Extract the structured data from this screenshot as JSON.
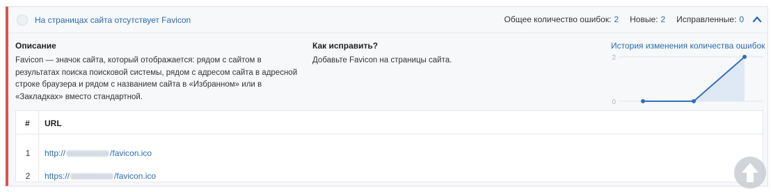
{
  "issue": {
    "title": "На страницах сайта отсутствует Favicon",
    "stats": {
      "total_label": "Общее количество ошибок:",
      "total_value": "2",
      "new_label": "Новые:",
      "new_value": "2",
      "fixed_label": "Исправленные:",
      "fixed_value": "0"
    }
  },
  "description": {
    "title": "Описание",
    "text": "Favicon — значок сайта, который отображается: рядом с сайтом в результатах поиска поисковой системы, рядом с адресом сайта в адресной строке браузера и рядом с названием сайта в «Избранном» или в «Закладках» вместо стандартной."
  },
  "fix": {
    "title": "Как исправить?",
    "text": "Добавьте Favicon на страницы сайта."
  },
  "history": {
    "title": "История изменения количества ошибок"
  },
  "chart_data": {
    "type": "area",
    "x": [
      1,
      2,
      3
    ],
    "series": [
      {
        "values": [
          0,
          0,
          2
        ]
      }
    ],
    "ylim": [
      0,
      2
    ],
    "y_ticks": [
      "0",
      "2"
    ],
    "grid": true,
    "colors": {
      "line": "#2f6fc0",
      "fill": "#dfe9f5",
      "grid": "#e1e4e8"
    }
  },
  "table": {
    "headers": [
      "#",
      "URL"
    ],
    "rows": [
      {
        "num": "1",
        "url_prefix": "http://",
        "url_suffix": "/favicon.ico"
      },
      {
        "num": "2",
        "url_prefix": "https://",
        "url_suffix": "/favicon.ico"
      }
    ]
  },
  "colors": {
    "accent": "#2a6bb0",
    "error_border": "#d9534f",
    "panel_bg": "#f7f8fa"
  },
  "icons": {
    "status": "empty-circle-icon",
    "collapse": "chevron-up-icon",
    "scroll_top": "arrow-up-icon"
  }
}
